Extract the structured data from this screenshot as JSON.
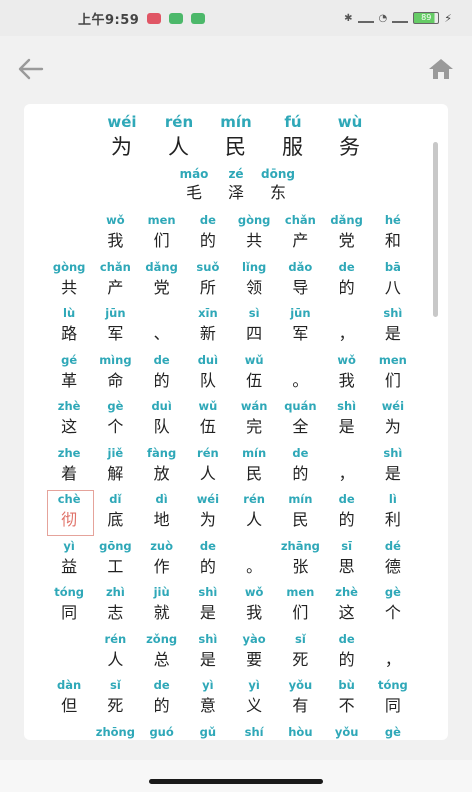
{
  "status_bar": {
    "time": "上午9:59",
    "battery": "89"
  },
  "nav": {
    "back_icon": "arrow-left-icon",
    "home_icon": "home-icon"
  },
  "title": [
    {
      "py": "wéi",
      "hz": "为"
    },
    {
      "py": "rén",
      "hz": "人"
    },
    {
      "py": "mín",
      "hz": "民"
    },
    {
      "py": "fú",
      "hz": "服"
    },
    {
      "py": "wù",
      "hz": "务"
    }
  ],
  "author": [
    {
      "py": "máo",
      "hz": "毛"
    },
    {
      "py": "zé",
      "hz": "泽"
    },
    {
      "py": "dōng",
      "hz": "东"
    }
  ],
  "rows": [
    [
      {
        "py": "",
        "hz": ""
      },
      {
        "py": "wǒ",
        "hz": "我"
      },
      {
        "py": "men",
        "hz": "们"
      },
      {
        "py": "de",
        "hz": "的"
      },
      {
        "py": "gòng",
        "hz": "共"
      },
      {
        "py": "chǎn",
        "hz": "产"
      },
      {
        "py": "dǎng",
        "hz": "党"
      },
      {
        "py": "hé",
        "hz": "和"
      }
    ],
    [
      {
        "py": "gòng",
        "hz": "共"
      },
      {
        "py": "chǎn",
        "hz": "产"
      },
      {
        "py": "dǎng",
        "hz": "党"
      },
      {
        "py": "suǒ",
        "hz": "所"
      },
      {
        "py": "lǐng",
        "hz": "领"
      },
      {
        "py": "dǎo",
        "hz": "导"
      },
      {
        "py": "de",
        "hz": "的"
      },
      {
        "py": "bā",
        "hz": "八"
      }
    ],
    [
      {
        "py": "lù",
        "hz": "路"
      },
      {
        "py": "jūn",
        "hz": "军"
      },
      {
        "py": "",
        "hz": "、"
      },
      {
        "py": "xīn",
        "hz": "新"
      },
      {
        "py": "sì",
        "hz": "四"
      },
      {
        "py": "jūn",
        "hz": "军"
      },
      {
        "py": "",
        "hz": "，"
      },
      {
        "py": "shì",
        "hz": "是"
      }
    ],
    [
      {
        "py": "gé",
        "hz": "革"
      },
      {
        "py": "mìng",
        "hz": "命"
      },
      {
        "py": "de",
        "hz": "的"
      },
      {
        "py": "duì",
        "hz": "队"
      },
      {
        "py": "wǔ",
        "hz": "伍"
      },
      {
        "py": "",
        "hz": "。"
      },
      {
        "py": "wǒ",
        "hz": "我"
      },
      {
        "py": "men",
        "hz": "们"
      }
    ],
    [
      {
        "py": "zhè",
        "hz": "这"
      },
      {
        "py": "gè",
        "hz": "个"
      },
      {
        "py": "duì",
        "hz": "队"
      },
      {
        "py": "wǔ",
        "hz": "伍"
      },
      {
        "py": "wán",
        "hz": "完"
      },
      {
        "py": "quán",
        "hz": "全"
      },
      {
        "py": "shì",
        "hz": "是"
      },
      {
        "py": "wéi",
        "hz": "为"
      }
    ],
    [
      {
        "py": "zhe",
        "hz": "着"
      },
      {
        "py": "jiě",
        "hz": "解"
      },
      {
        "py": "fàng",
        "hz": "放"
      },
      {
        "py": "rén",
        "hz": "人"
      },
      {
        "py": "mín",
        "hz": "民"
      },
      {
        "py": "de",
        "hz": "的"
      },
      {
        "py": "",
        "hz": "，"
      },
      {
        "py": "shì",
        "hz": "是"
      }
    ],
    [
      {
        "py": "chè",
        "hz": "彻",
        "highlight": true
      },
      {
        "py": "dǐ",
        "hz": "底"
      },
      {
        "py": "dì",
        "hz": "地"
      },
      {
        "py": "wéi",
        "hz": "为"
      },
      {
        "py": "rén",
        "hz": "人"
      },
      {
        "py": "mín",
        "hz": "民"
      },
      {
        "py": "de",
        "hz": "的"
      },
      {
        "py": "lì",
        "hz": "利"
      }
    ],
    [
      {
        "py": "yì",
        "hz": "益"
      },
      {
        "py": "gōng",
        "hz": "工"
      },
      {
        "py": "zuò",
        "hz": "作"
      },
      {
        "py": "de",
        "hz": "的"
      },
      {
        "py": "",
        "hz": "。"
      },
      {
        "py": "zhāng",
        "hz": "张"
      },
      {
        "py": "sī",
        "hz": "思"
      },
      {
        "py": "dé",
        "hz": "德"
      }
    ],
    [
      {
        "py": "tóng",
        "hz": "同"
      },
      {
        "py": "zhì",
        "hz": "志"
      },
      {
        "py": "jiù",
        "hz": "就"
      },
      {
        "py": "shì",
        "hz": "是"
      },
      {
        "py": "wǒ",
        "hz": "我"
      },
      {
        "py": "men",
        "hz": "们"
      },
      {
        "py": "zhè",
        "hz": "这"
      },
      {
        "py": "gè",
        "hz": "个"
      }
    ],
    [
      {
        "py": "",
        "hz": ""
      },
      {
        "py": "rén",
        "hz": "人"
      },
      {
        "py": "zǒng",
        "hz": "总"
      },
      {
        "py": "shì",
        "hz": "是"
      },
      {
        "py": "yào",
        "hz": "要"
      },
      {
        "py": "sǐ",
        "hz": "死"
      },
      {
        "py": "de",
        "hz": "的"
      },
      {
        "py": "",
        "hz": "，"
      }
    ],
    [
      {
        "py": "dàn",
        "hz": "但"
      },
      {
        "py": "sǐ",
        "hz": "死"
      },
      {
        "py": "de",
        "hz": "的"
      },
      {
        "py": "yì",
        "hz": "意"
      },
      {
        "py": "yì",
        "hz": "义"
      },
      {
        "py": "yǒu",
        "hz": "有"
      },
      {
        "py": "bù",
        "hz": "不"
      },
      {
        "py": "tóng",
        "hz": "同"
      }
    ],
    [
      {
        "py": "",
        "hz": ""
      },
      {
        "py": "zhōng",
        "hz": ""
      },
      {
        "py": "guó",
        "hz": ""
      },
      {
        "py": "gǔ",
        "hz": ""
      },
      {
        "py": "shí",
        "hz": ""
      },
      {
        "py": "hòu",
        "hz": ""
      },
      {
        "py": "yǒu",
        "hz": ""
      },
      {
        "py": "gè",
        "hz": ""
      }
    ]
  ]
}
